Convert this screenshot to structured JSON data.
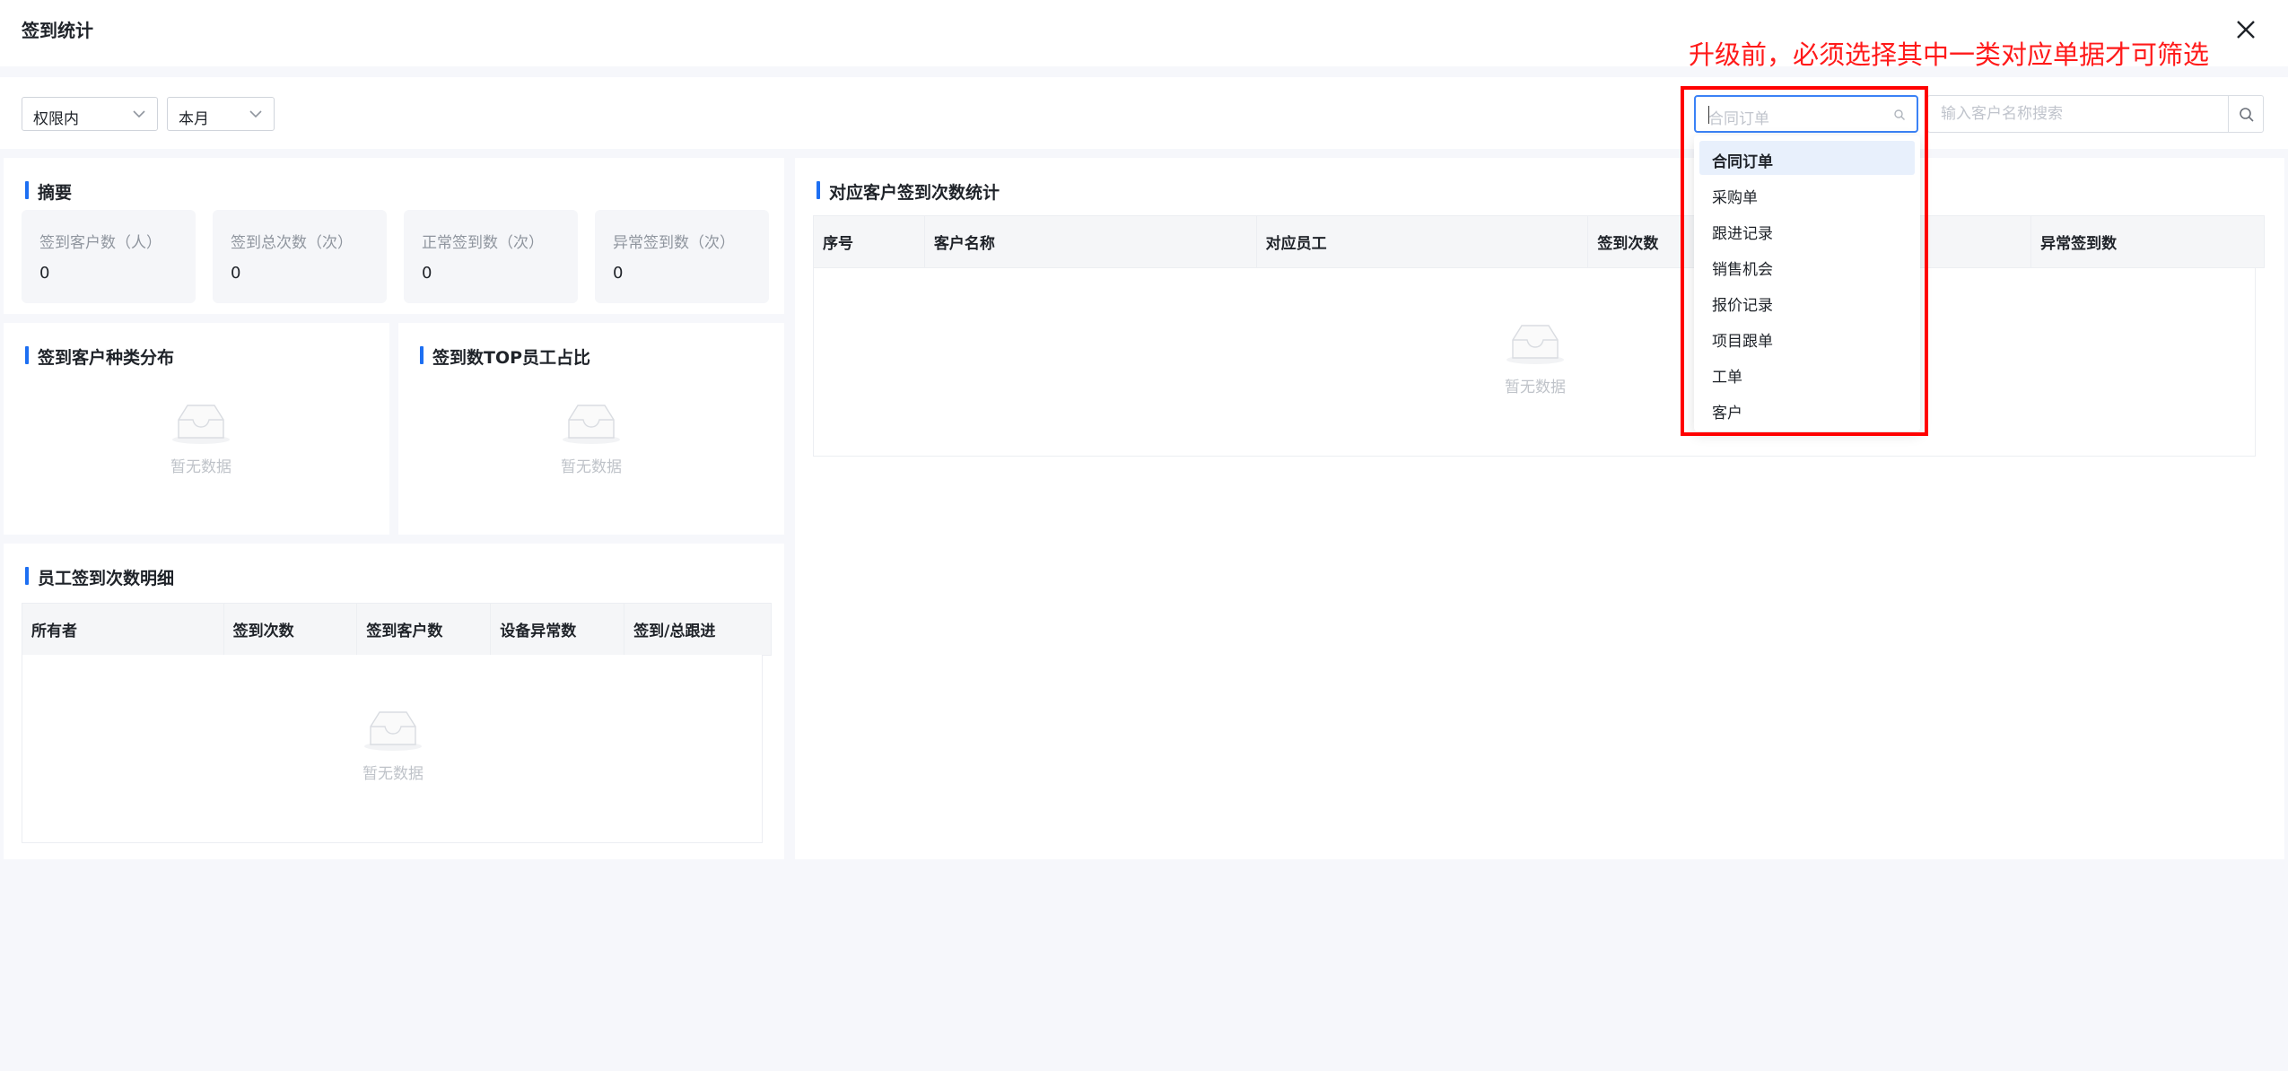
{
  "window": {
    "title": "签到统计"
  },
  "filters": {
    "scope": "权限内",
    "period": "本月",
    "type_select_placeholder": "合同订单",
    "search_placeholder": "输入客户名称搜索"
  },
  "summary": {
    "title": "摘要",
    "cards": [
      {
        "label": "签到客户数（人）",
        "value": "0"
      },
      {
        "label": "签到总次数（次）",
        "value": "0"
      },
      {
        "label": "正常签到数（次）",
        "value": "0"
      },
      {
        "label": "异常签到数（次）",
        "value": "0"
      }
    ]
  },
  "customer_type_panel": {
    "title": "签到客户种类分布",
    "empty": "暂无数据"
  },
  "top_employee_panel": {
    "title": "签到数TOP员工占比",
    "empty": "暂无数据"
  },
  "employee_detail": {
    "title": "员工签到次数明细",
    "columns": [
      "所有者",
      "签到次数",
      "签到客户数",
      "设备异常数",
      "签到/总跟进"
    ],
    "empty": "暂无数据"
  },
  "customer_stats": {
    "title": "对应客户签到次数统计",
    "columns": [
      "序号",
      "客户名称",
      "对应员工",
      "签到次数",
      "",
      "异常签到数"
    ],
    "empty": "暂无数据"
  },
  "dropdown": {
    "options": [
      "合同订单",
      "采购单",
      "跟进记录",
      "销售机会",
      "报价记录",
      "项目跟单",
      "工单",
      "客户"
    ],
    "selected_index": 0
  },
  "annotation": {
    "text": "升级前，必须选择其中一类对应单据才可筛选"
  },
  "colors": {
    "accent": "#1d6ff2",
    "annotation": "#ff0000",
    "selected_bg": "#e8f0fc"
  }
}
